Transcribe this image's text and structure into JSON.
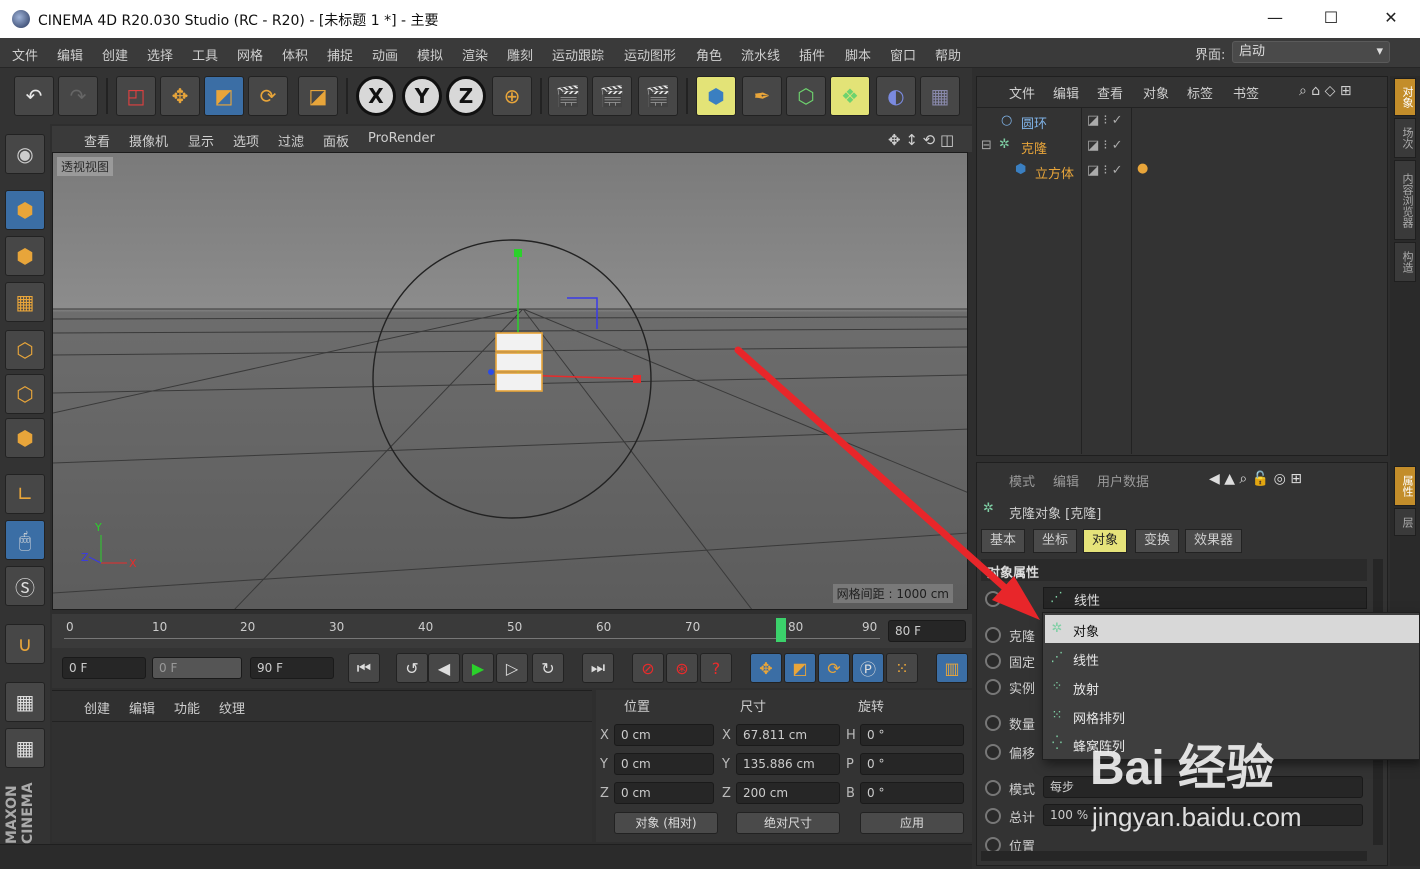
{
  "title": "CINEMA 4D R20.030 Studio (RC - R20) - [未标题 1 *] - 主要",
  "menu": [
    "文件",
    "编辑",
    "创建",
    "选择",
    "工具",
    "网格",
    "体积",
    "捕捉",
    "动画",
    "模拟",
    "渲染",
    "雕刻",
    "运动跟踪",
    "运动图形",
    "角色",
    "流水线",
    "插件",
    "脚本",
    "窗口",
    "帮助"
  ],
  "layout_label": "界面:",
  "layout_value": "启动",
  "viewport_menu": [
    "查看",
    "摄像机",
    "显示",
    "选项",
    "过滤",
    "面板",
    "ProRender"
  ],
  "viewport_label": "透视视图",
  "grid_spacing": "网格间距 : 1000 cm",
  "axis_labels": {
    "y": "Y",
    "z": "Z",
    "x": "X"
  },
  "timeline_ticks": [
    "0",
    "10",
    "20",
    "30",
    "40",
    "50",
    "60",
    "70",
    "80",
    "90"
  ],
  "timeline_end": "80 F",
  "playback": {
    "start": "0 F",
    "current": "0 F",
    "end": "90 F"
  },
  "material_menu": [
    "创建",
    "编辑",
    "功能",
    "纹理"
  ],
  "coords": {
    "headers": [
      "位置",
      "尺寸",
      "旋转"
    ],
    "rows": [
      {
        "a1": "X",
        "v1": "0 cm",
        "a2": "X",
        "v2": "67.811 cm",
        "a3": "H",
        "v3": "0 °"
      },
      {
        "a1": "Y",
        "v1": "0 cm",
        "a2": "Y",
        "v2": "135.886 cm",
        "a3": "P",
        "v3": "0 °"
      },
      {
        "a1": "Z",
        "v1": "0 cm",
        "a2": "Z",
        "v2": "200 cm",
        "a3": "B",
        "v3": "0 °"
      }
    ],
    "mode": "对象 (相对)",
    "size_mode": "绝对尺寸",
    "apply": "应用"
  },
  "object_menu": [
    "文件",
    "编辑",
    "查看",
    "对象",
    "标签",
    "书签"
  ],
  "objects": [
    {
      "name": "圆环",
      "color": "#7fb2e6"
    },
    {
      "name": "克隆",
      "color": "#e8a53a"
    },
    {
      "name": "立方体",
      "color": "#e8a53a"
    }
  ],
  "side_tabs": [
    "对象",
    "场次",
    "内容浏览器",
    "构造"
  ],
  "side_tabs2": [
    "属性",
    "层"
  ],
  "attr_menu": [
    "模式",
    "编辑",
    "用户数据"
  ],
  "attr_title": "克隆对象 [克隆]",
  "attr_tabs": [
    "基本",
    "坐标",
    "对象",
    "变换",
    "效果器"
  ],
  "attr_section": "对象属性",
  "attr_mode_value": "线性",
  "attr_rows": [
    "克隆",
    "固定",
    "实例",
    "数量",
    "偏移",
    "模式",
    "总计",
    "位置"
  ],
  "attr_mode_step": "每步",
  "attr_total": "100 %",
  "dropdown": [
    {
      "label": "对象",
      "icon": "✲"
    },
    {
      "label": "线性",
      "icon": "⋰"
    },
    {
      "label": "放射",
      "icon": "⁘"
    },
    {
      "label": "网格排列",
      "icon": "⁙"
    },
    {
      "label": "蜂窝阵列",
      "icon": "⁛"
    }
  ],
  "watermark": {
    "main": "Bai 经验",
    "sub": "jingyan.baidu.com"
  },
  "colors": {
    "accent_yellow": "#e6e37a",
    "accent_blue": "#3b6ea5",
    "arrow_red": "#e8262a"
  }
}
